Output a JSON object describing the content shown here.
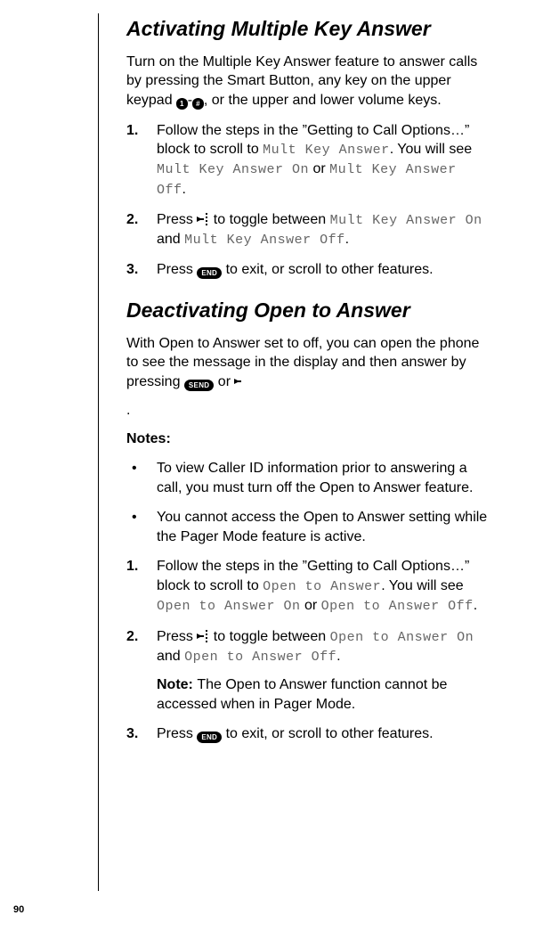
{
  "pageNumber": "90",
  "section1": {
    "heading": "Activating Multiple Key Answer",
    "intro_a": "Turn on the Multiple Key Answer feature to answer calls by pressing the Smart Button, any key on the upper keypad ",
    "intro_b": ", or the upper and lower volume keys.",
    "key1": "1",
    "keyDash": "-",
    "keyHash": "#",
    "steps": {
      "s1": {
        "num": "1.",
        "t1": "Follow the steps in the ”Getting to Call Options…” block to scroll to ",
        "lcd1": "Mult Key Answer",
        "t2": ". You will see ",
        "lcd2": "Mult Key Answer On",
        "t3": " or ",
        "lcd3": "Mult Key Answer Off",
        "t4": "."
      },
      "s2": {
        "num": "2.",
        "t1": "Press ",
        "t2": " to toggle between ",
        "lcd1": "Mult Key Answer On",
        "t3": " and ",
        "lcd2": "Mult Key Answer Off",
        "t4": "."
      },
      "s3": {
        "num": "3.",
        "t1": "Press ",
        "key": "END",
        "t2": " to exit, or scroll to other features."
      }
    }
  },
  "section2": {
    "heading": "Deactivating Open to Answer",
    "intro_a": "With Open to Answer set to off, you can open the phone to see the message in the display and then answer by pressing ",
    "keySend": "SEND",
    "intro_b": " or ",
    "intro_c": ".",
    "notesLabel": "Notes:",
    "bullets": {
      "b1": "To view Caller ID information prior to answering a call, you must turn off the Open to Answer feature.",
      "b2": "You cannot access the Open to Answer setting while the Pager Mode feature is active."
    },
    "steps": {
      "s1": {
        "num": "1.",
        "t1": "Follow the steps in the ”Getting to Call Options…” block to scroll to ",
        "lcd1": "Open to Answer",
        "t2": ". You will see ",
        "lcd2": "Open to Answer On",
        "t3": " or ",
        "lcd3": "Open to Answer Off",
        "t4": "."
      },
      "s2": {
        "num": "2.",
        "t1": "Press ",
        "t2": " to toggle between ",
        "lcd1": "Open to Answer On",
        "t3": " and ",
        "lcd2": "Open to Answer Off",
        "t4": ".",
        "noteLabel": "Note: ",
        "noteText": "The Open to Answer function cannot be accessed when in Pager Mode."
      },
      "s3": {
        "num": "3.",
        "t1": "Press ",
        "key": "END",
        "t2": " to exit, or scroll to other features."
      }
    }
  }
}
